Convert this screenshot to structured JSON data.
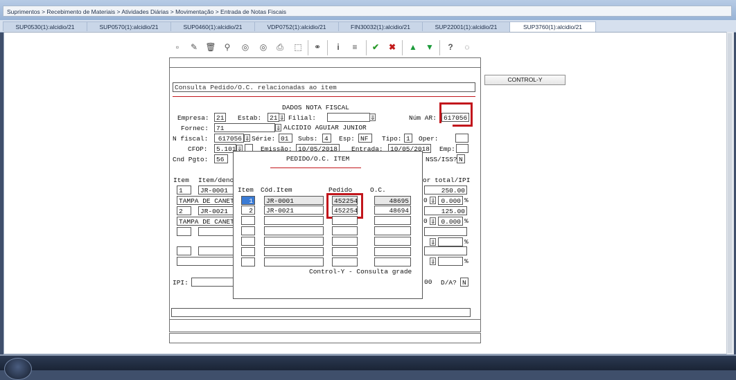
{
  "breadcrumb": "Suprimentos > Recebimento de Materiais > Atividades Diárias > Movimentação > Entrada de Notas Fiscais",
  "tabs": [
    {
      "label": "SUP0530(1):alcidio/21"
    },
    {
      "label": "SUP0570(1):alcidio/21"
    },
    {
      "label": "SUP0460(1):alcidio/21"
    },
    {
      "label": "VDP0752(1):alcidio/21"
    },
    {
      "label": "FIN30032(1):alcidio/21"
    },
    {
      "label": "SUP22001(1):alcidio/21"
    },
    {
      "label": "SUP3760(1):alcidio/21"
    }
  ],
  "active_tab": "SUP3760(1):alcidio/21",
  "toolbar_icons": [
    "new-icon",
    "edit-icon",
    "delete-icon",
    "search-icon",
    "previous-icon",
    "next-icon",
    "print-icon",
    "export-icon",
    "find-icon",
    "info-icon",
    "list-icon",
    "confirm-icon",
    "cancel-icon",
    "up-icon",
    "down-icon",
    "help-icon",
    "chat-icon"
  ],
  "control_y_button": "CONTROL-Y",
  "form": {
    "consulta": "Consulta Pedido/O.C. relacionadas ao item",
    "section_title": "DADOS NOTA FISCAL",
    "empresa_label": "Empresa:",
    "empresa": "21",
    "estab_label": "Estab:",
    "estab": "21",
    "filial_label": "Filial:",
    "filial": "",
    "num_ar_label": "Núm AR:",
    "num_ar": "617056",
    "fornec_label": "Fornec:",
    "fornec": "71",
    "fornec_nome": "ALCIDIO AGUIAR JUNIOR",
    "nfiscal_label": "N fiscal:",
    "nfiscal": "617056",
    "serie_label": "Série:",
    "serie": "01",
    "subs_label": "Subs:",
    "subs": "4",
    "esp_label": "Esp:",
    "esp": "NF",
    "tipo_label": "Tipo:",
    "tipo": "1",
    "oper_label": "Oper:",
    "oper": "",
    "cfop_label": "CFOP:",
    "cfop": "5.101",
    "emissao_label": "Emissão:",
    "emissao": "10/05/2018",
    "entrada_label": "Entrada:",
    "entrada": "10/05/2018",
    "emp_label": "Emp:",
    "emp": "",
    "cndpgto_label": "Cnd Pgto:",
    "cndpgto": "56",
    "nss_label": "NSS/ISS?",
    "nss": "N",
    "grid_header_item": "Item",
    "grid_header_itemdeno": "Item/deno",
    "grid_header_total": "or total/IPI",
    "rows": [
      {
        "item": "1",
        "code": "JR-0001",
        "desc": "TAMPA DE CANETA",
        "total": "250.00",
        "ipi_prefix": "0",
        "ipi": "0.000",
        "pct": "%"
      },
      {
        "item": "2",
        "code": "JR-0021",
        "desc": "TAMPA DE CANETA",
        "total": "125.00",
        "ipi_prefix": "0",
        "ipi": "0.000",
        "pct": "%"
      }
    ],
    "pct_sign": "%",
    "ipi_label": "IPI:",
    "bottom_val": "00",
    "da_label": "D/A?",
    "da": "N"
  },
  "popup": {
    "title": "PEDIDO/O.C. ITEM",
    "col_item": "Item",
    "col_cod": "Cód.Item",
    "col_pedido": "Pedido",
    "col_oc": "O.C.",
    "rows": [
      {
        "item": "1",
        "cod": "JR-0001",
        "pedido": "452254",
        "oc": "48695"
      },
      {
        "item": "2",
        "cod": "JR-0021",
        "pedido": "452254",
        "oc": "48694"
      }
    ],
    "footer": "Control-Y - Consulta grade"
  },
  "colors": {
    "highlight": "#c2161c",
    "header": "#98b3d6",
    "selected": "#3a7bd5"
  }
}
